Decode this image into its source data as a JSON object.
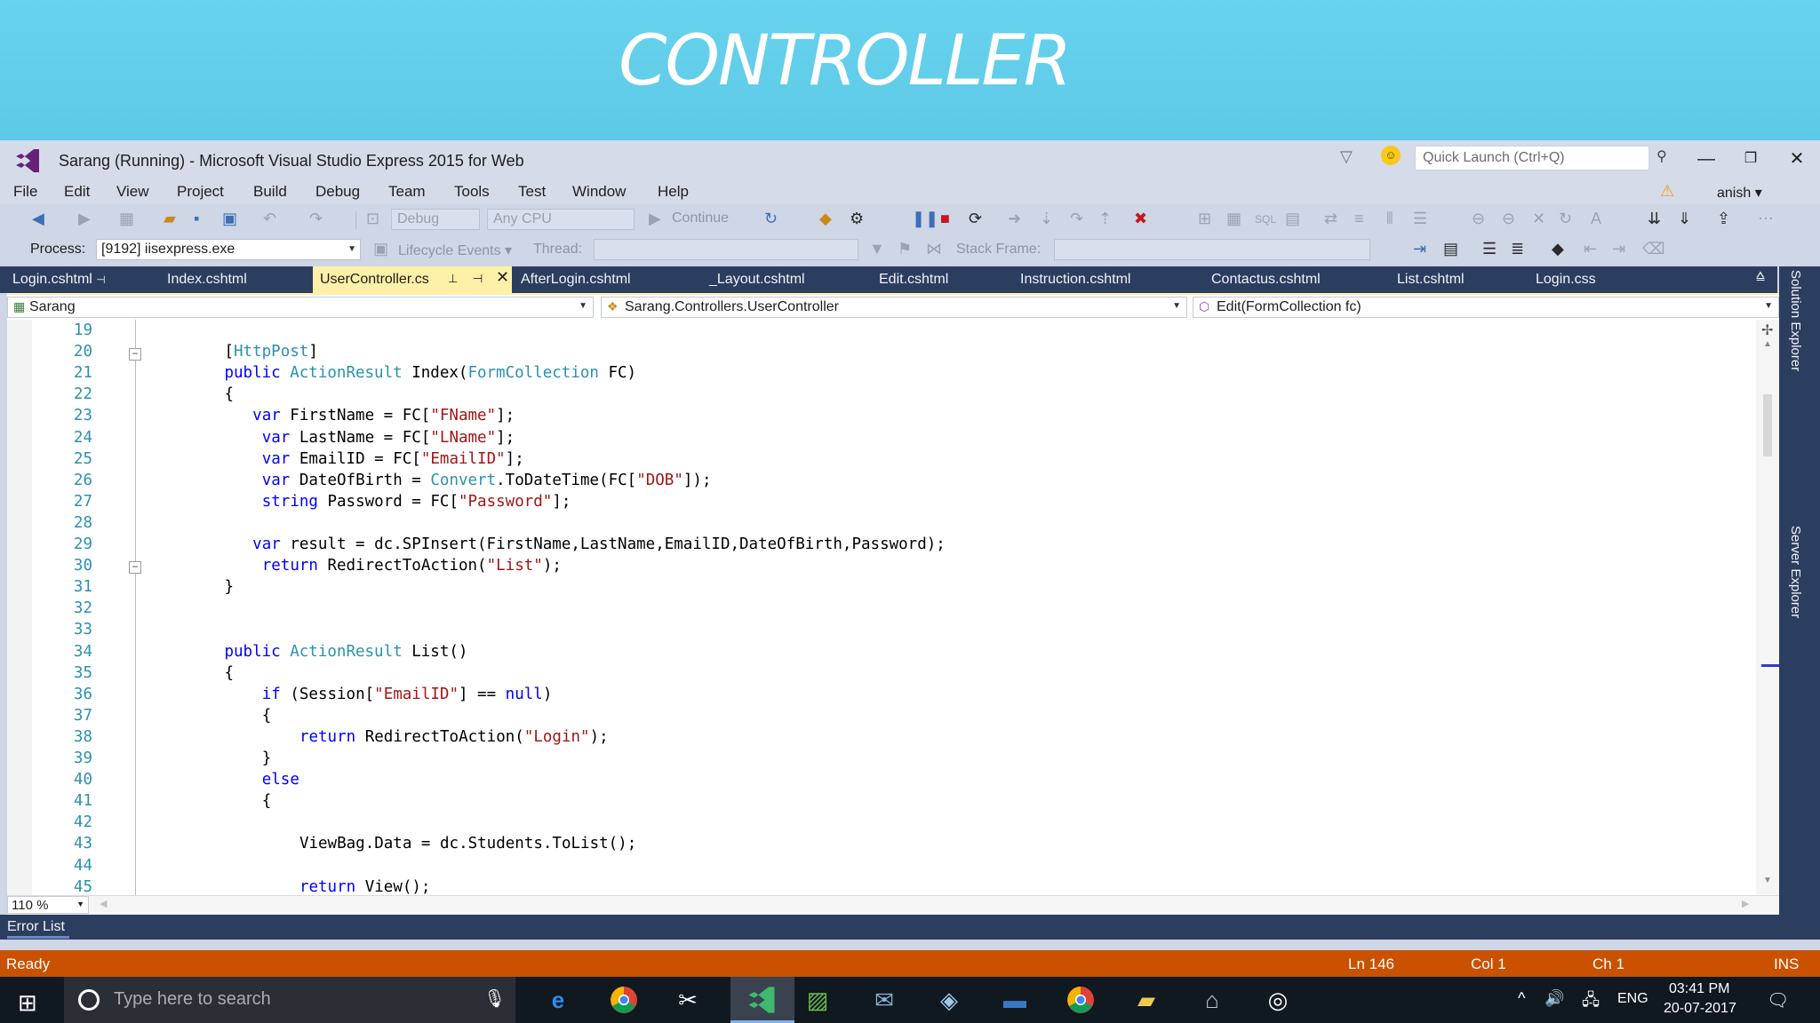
{
  "banner": {
    "title": "CONTROLLER"
  },
  "window": {
    "title": "Sarang (Running) - Microsoft Visual Studio Express 2015 for Web",
    "quick_launch_placeholder": "Quick Launch (Ctrl+Q)",
    "user": "anish"
  },
  "menu": [
    "File",
    "Edit",
    "View",
    "Project",
    "Build",
    "Debug",
    "Team",
    "Tools",
    "Test",
    "Window",
    "Help"
  ],
  "toolbar1": {
    "config": "Debug",
    "platform": "Any CPU",
    "continue_label": "Continue"
  },
  "toolbar2": {
    "process_label": "Process:",
    "process_value": "[9192] iisexpress.exe",
    "lifecycle_label": "Lifecycle Events",
    "thread_label": "Thread:",
    "stack_frame_label": "Stack Frame:"
  },
  "tabs": [
    "Login.cshtml",
    "Index.cshtml",
    "UserController.cs",
    "AfterLogin.cshtml",
    "_Layout.cshtml",
    "Edit.cshtml",
    "Instruction.cshtml",
    "Contactus.cshtml",
    "List.cshtml",
    "Login.css"
  ],
  "active_tab": "UserController.cs",
  "navbar": {
    "project": "Sarang",
    "class": "Sarang.Controllers.UserController",
    "member": "Edit(FormCollection fc)"
  },
  "code_lines": [
    {
      "n": "19",
      "indent": 0,
      "tokens": []
    },
    {
      "n": "20",
      "indent": 8,
      "tokens": [
        [
          "p",
          "["
        ],
        [
          "ty",
          "HttpPost"
        ],
        [
          "p",
          "]"
        ]
      ]
    },
    {
      "n": "21",
      "indent": 8,
      "tokens": [
        [
          "kw",
          "public"
        ],
        [
          "p",
          " "
        ],
        [
          "ty",
          "ActionResult"
        ],
        [
          "p",
          " Index("
        ],
        [
          "ty",
          "FormCollection"
        ],
        [
          "p",
          " FC)"
        ]
      ]
    },
    {
      "n": "22",
      "indent": 8,
      "tokens": [
        [
          "p",
          "{"
        ]
      ]
    },
    {
      "n": "23",
      "indent": 11,
      "tokens": [
        [
          "kw",
          "var"
        ],
        [
          "p",
          " FirstName = FC["
        ],
        [
          "str",
          "\"FName\""
        ],
        [
          "p",
          "];"
        ]
      ]
    },
    {
      "n": "24",
      "indent": 12,
      "tokens": [
        [
          "kw",
          "var"
        ],
        [
          "p",
          " LastName = FC["
        ],
        [
          "str",
          "\"LName\""
        ],
        [
          "p",
          "];"
        ]
      ]
    },
    {
      "n": "25",
      "indent": 12,
      "tokens": [
        [
          "kw",
          "var"
        ],
        [
          "p",
          " EmailID = FC["
        ],
        [
          "str",
          "\"EmailID\""
        ],
        [
          "p",
          "];"
        ]
      ]
    },
    {
      "n": "26",
      "indent": 12,
      "tokens": [
        [
          "kw",
          "var"
        ],
        [
          "p",
          " DateOfBirth = "
        ],
        [
          "ty",
          "Convert"
        ],
        [
          "p",
          ".ToDateTime(FC["
        ],
        [
          "str",
          "\"DOB\""
        ],
        [
          "p",
          "]);"
        ]
      ]
    },
    {
      "n": "27",
      "indent": 12,
      "tokens": [
        [
          "kw",
          "string"
        ],
        [
          "p",
          " Password = FC["
        ],
        [
          "str",
          "\"Password\""
        ],
        [
          "p",
          "];"
        ]
      ]
    },
    {
      "n": "28",
      "indent": 0,
      "tokens": []
    },
    {
      "n": "29",
      "indent": 11,
      "tokens": [
        [
          "kw",
          "var"
        ],
        [
          "p",
          " result = dc.SPInsert(FirstName,LastName,EmailID,DateOfBirth,Password);"
        ]
      ]
    },
    {
      "n": "30",
      "indent": 12,
      "tokens": [
        [
          "kw",
          "return"
        ],
        [
          "p",
          " RedirectToAction("
        ],
        [
          "str",
          "\"List\""
        ],
        [
          "p",
          ");"
        ]
      ]
    },
    {
      "n": "31",
      "indent": 8,
      "tokens": [
        [
          "p",
          "}"
        ]
      ]
    },
    {
      "n": "32",
      "indent": 0,
      "tokens": []
    },
    {
      "n": "33",
      "indent": 0,
      "tokens": []
    },
    {
      "n": "34",
      "indent": 8,
      "tokens": [
        [
          "kw",
          "public"
        ],
        [
          "p",
          " "
        ],
        [
          "ty",
          "ActionResult"
        ],
        [
          "p",
          " List()"
        ]
      ]
    },
    {
      "n": "35",
      "indent": 8,
      "tokens": [
        [
          "p",
          "{"
        ]
      ]
    },
    {
      "n": "36",
      "indent": 12,
      "tokens": [
        [
          "kw",
          "if"
        ],
        [
          "p",
          " (Session["
        ],
        [
          "str",
          "\"EmailID\""
        ],
        [
          "p",
          "] == "
        ],
        [
          "kw",
          "null"
        ],
        [
          "p",
          ")"
        ]
      ]
    },
    {
      "n": "37",
      "indent": 12,
      "tokens": [
        [
          "p",
          "{"
        ]
      ]
    },
    {
      "n": "38",
      "indent": 16,
      "tokens": [
        [
          "kw",
          "return"
        ],
        [
          "p",
          " RedirectToAction("
        ],
        [
          "str",
          "\"Login\""
        ],
        [
          "p",
          ");"
        ]
      ]
    },
    {
      "n": "39",
      "indent": 12,
      "tokens": [
        [
          "p",
          "}"
        ]
      ]
    },
    {
      "n": "40",
      "indent": 12,
      "tokens": [
        [
          "kw",
          "else"
        ]
      ]
    },
    {
      "n": "41",
      "indent": 12,
      "tokens": [
        [
          "p",
          "{"
        ]
      ]
    },
    {
      "n": "42",
      "indent": 0,
      "tokens": []
    },
    {
      "n": "43",
      "indent": 16,
      "tokens": [
        [
          "p",
          "ViewBag.Data = dc.Students.ToList();"
        ]
      ]
    },
    {
      "n": "44",
      "indent": 0,
      "tokens": []
    },
    {
      "n": "45",
      "indent": 16,
      "tokens": [
        [
          "kw",
          "return"
        ],
        [
          "p",
          " View();"
        ]
      ]
    }
  ],
  "zoom": "110 %",
  "side_panel": {
    "solution_explorer": "Solution Explorer",
    "server_explorer": "Server Explorer"
  },
  "error_list": "Error List",
  "status": {
    "ready": "Ready",
    "line": "Ln 146",
    "col": "Col 1",
    "ch": "Ch 1",
    "ins": "INS"
  },
  "taskbar": {
    "search_placeholder": "Type here to search",
    "lang": "ENG",
    "time": "03:41 PM",
    "date": "20-07-2017"
  },
  "colors": {
    "accent_status": "#ca5100",
    "tab_bar": "#2c3e5f",
    "active_tab": "#fff0a8",
    "banner": "#5fcde8"
  }
}
